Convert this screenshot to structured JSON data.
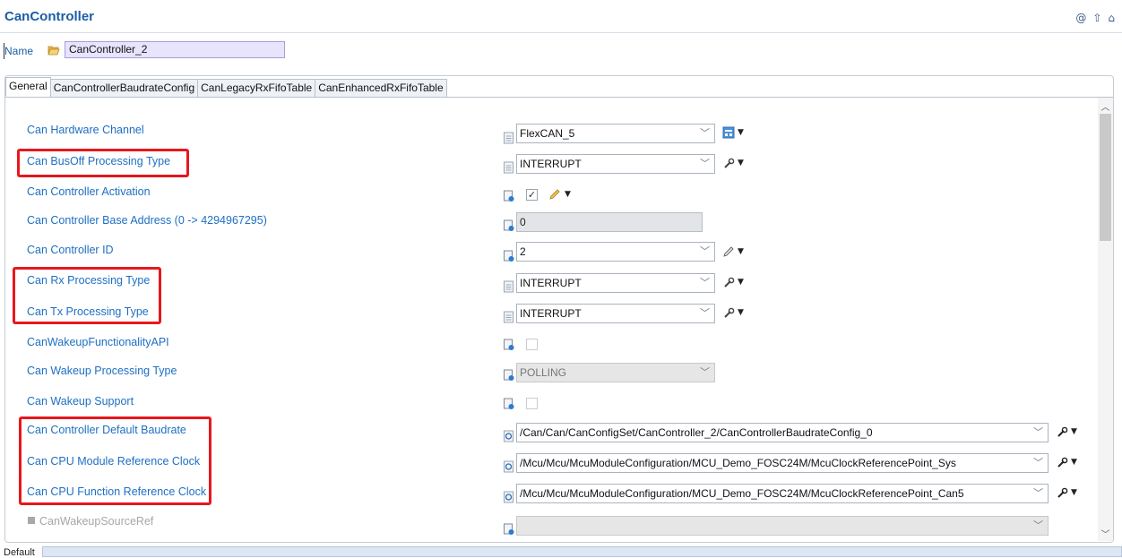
{
  "header": {
    "title": "CanController",
    "icons": [
      "at-icon",
      "up-arrow-icon",
      "home-icon"
    ]
  },
  "name_row": {
    "label": "Name",
    "value": "CanController_2"
  },
  "tabs": [
    {
      "label": "General",
      "active": true
    },
    {
      "label": "CanControllerBaudrateConfig",
      "active": false
    },
    {
      "label": "CanLegacyRxFifoTable",
      "active": false
    },
    {
      "label": "CanEnhancedRxFifoTable",
      "active": false
    }
  ],
  "rows": {
    "hw_channel": {
      "label": "Can Hardware Channel",
      "value": "FlexCAN_5"
    },
    "busoff": {
      "label": "Can BusOff Processing Type",
      "value": "INTERRUPT"
    },
    "activation": {
      "label": "Can Controller Activation",
      "checked": true
    },
    "base_addr": {
      "label": "Can Controller Base Address (0 -> 4294967295)",
      "value": "0"
    },
    "ctrl_id": {
      "label": "Can Controller ID",
      "value": "2"
    },
    "rx": {
      "label": "Can Rx Processing Type",
      "value": "INTERRUPT"
    },
    "tx": {
      "label": "Can Tx Processing Type",
      "value": "INTERRUPT"
    },
    "wakeup_api": {
      "label": "CanWakeupFunctionalityAPI",
      "checked": false
    },
    "wakeup_proc": {
      "label": "Can Wakeup Processing Type",
      "value": "POLLING"
    },
    "wakeup_support": {
      "label": "Can Wakeup Support",
      "checked": false
    },
    "default_baud": {
      "label": "Can Controller Default Baudrate",
      "value": "/Can/Can/CanConfigSet/CanController_2/CanControllerBaudrateConfig_0"
    },
    "cpu_module_clk": {
      "label": "Can CPU Module Reference Clock",
      "value": "/Mcu/Mcu/McuModuleConfiguration/MCU_Demo_FOSC24M/McuClockReferencePoint_Sys"
    },
    "cpu_function_clk": {
      "label": "Can CPU Function Reference Clock",
      "value": "/Mcu/Mcu/McuModuleConfiguration/MCU_Demo_FOSC24M/McuClockReferencePoint_Can5"
    },
    "wakeup_src": {
      "label": "CanWakeupSourceRef",
      "value": ""
    }
  },
  "status": {
    "tab_label": "Default"
  },
  "colors": {
    "label_blue": "#1e6fc4",
    "title_blue": "#1a5ea8",
    "highlight_red": "#e8171c",
    "name_field_bg": "#e8e4fb"
  }
}
